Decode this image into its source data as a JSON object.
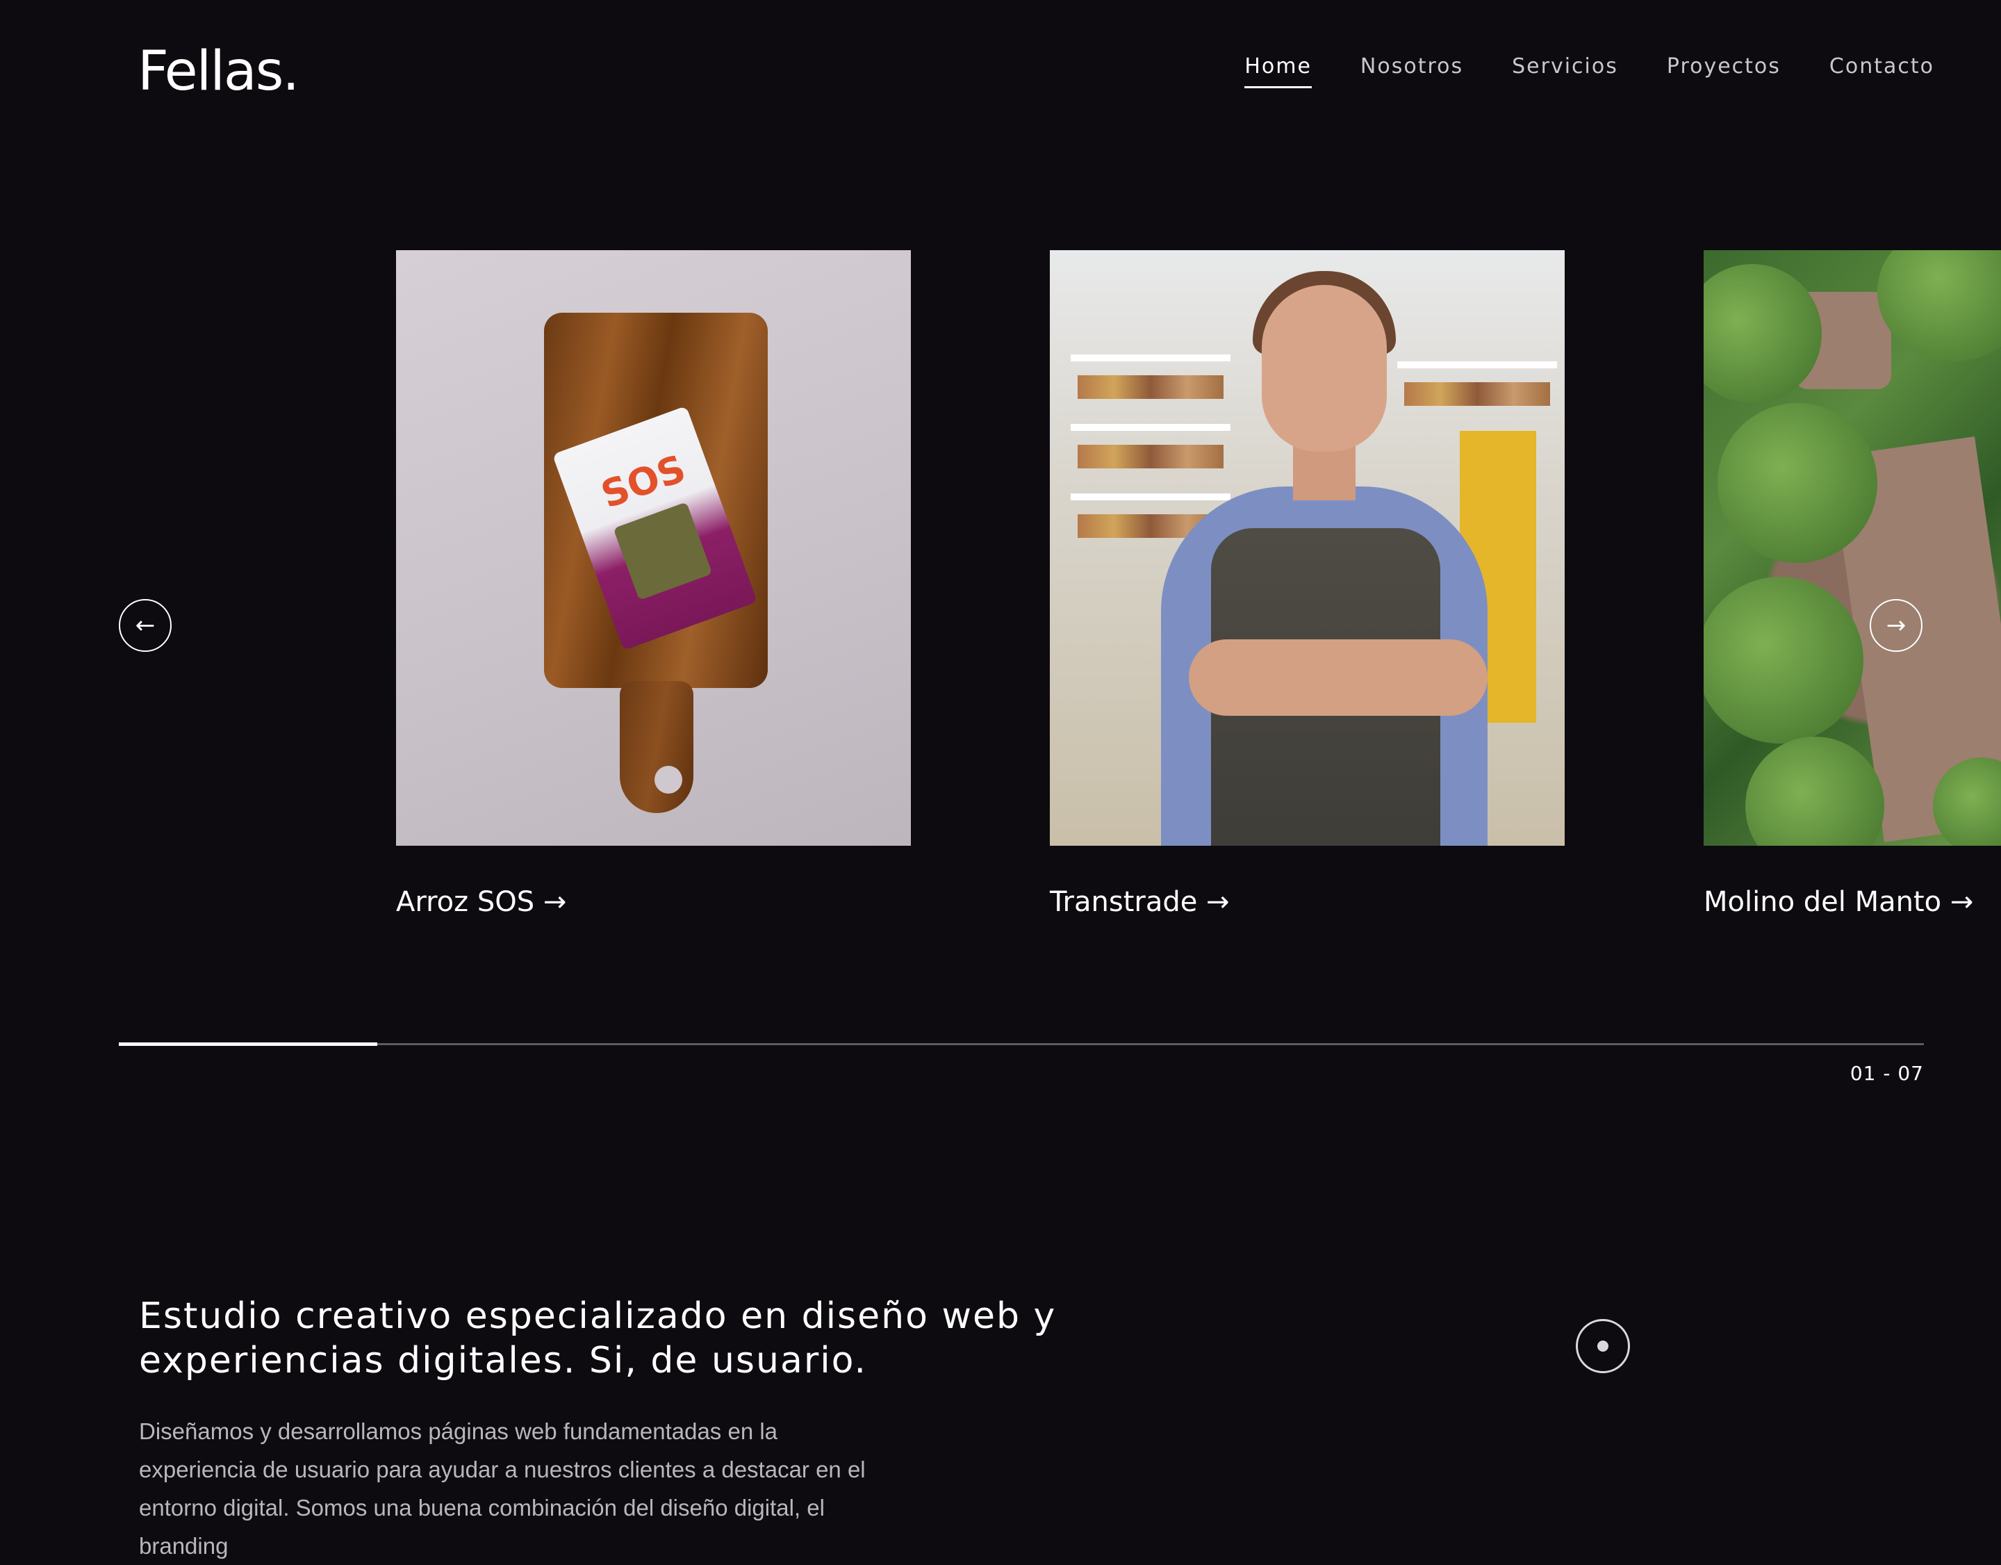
{
  "header": {
    "logo": "Fellas.",
    "nav": [
      {
        "label": "Home",
        "active": true
      },
      {
        "label": "Nosotros",
        "active": false
      },
      {
        "label": "Servicios",
        "active": false
      },
      {
        "label": "Proyectos",
        "active": false
      },
      {
        "label": "Contacto",
        "active": false
      }
    ]
  },
  "carousel": {
    "prev_icon": "arrow-left-icon",
    "next_icon": "arrow-right-icon",
    "prev_glyph": "←",
    "next_glyph": "→",
    "projects": [
      {
        "title": "Arroz SOS →",
        "image": "cutting board with SOS quinoa package"
      },
      {
        "title": "Transtrade →",
        "image": "smiling woman in apron inside grocery store"
      },
      {
        "title": "Molino del Manto →",
        "image": "aerial view of garden with tables and trees"
      }
    ],
    "product_label": "SOS",
    "progress_fraction": 0.143,
    "counter": "01 - 07"
  },
  "intro": {
    "headline_line1": "Estudio creativo especializado en diseño web y",
    "headline_line2": "experiencias digitales. Si, de usuario.",
    "body_line1": "Diseñamos y desarrollamos páginas web fundamentadas en la",
    "body_line2": "experiencia de usuario para ayudar a nuestros clientes a destacar en el",
    "body_line3": "entorno digital. Somos una buena combinación del diseño digital, el branding",
    "scroll_icon": "scroll-indicator-icon"
  },
  "colors": {
    "background": "#0d0b0f",
    "text": "#ffffff",
    "muted_text": "#b9b7bc"
  }
}
